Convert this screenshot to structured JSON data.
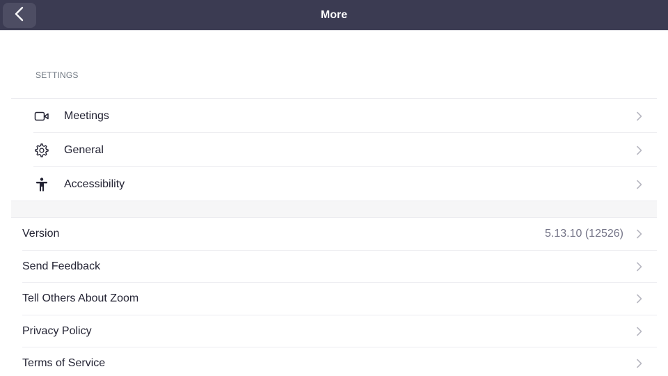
{
  "header": {
    "title": "More",
    "back_icon": "chevron-left-icon"
  },
  "settings": {
    "section_label": "SETTINGS",
    "items": [
      {
        "label": "Meetings",
        "icon": "video-camera-icon"
      },
      {
        "label": "General",
        "icon": "gear-icon"
      },
      {
        "label": "Accessibility",
        "icon": "accessibility-icon"
      }
    ]
  },
  "about": {
    "items": [
      {
        "label": "Version",
        "value": "5.13.10 (12526)"
      },
      {
        "label": "Send Feedback"
      },
      {
        "label": "Tell Others About Zoom"
      },
      {
        "label": "Privacy Policy"
      },
      {
        "label": "Terms of Service"
      }
    ]
  },
  "colors": {
    "header_bg": "#3b3b52",
    "text": "#232333",
    "muted": "#747487",
    "chevron": "#b8b8c2"
  }
}
